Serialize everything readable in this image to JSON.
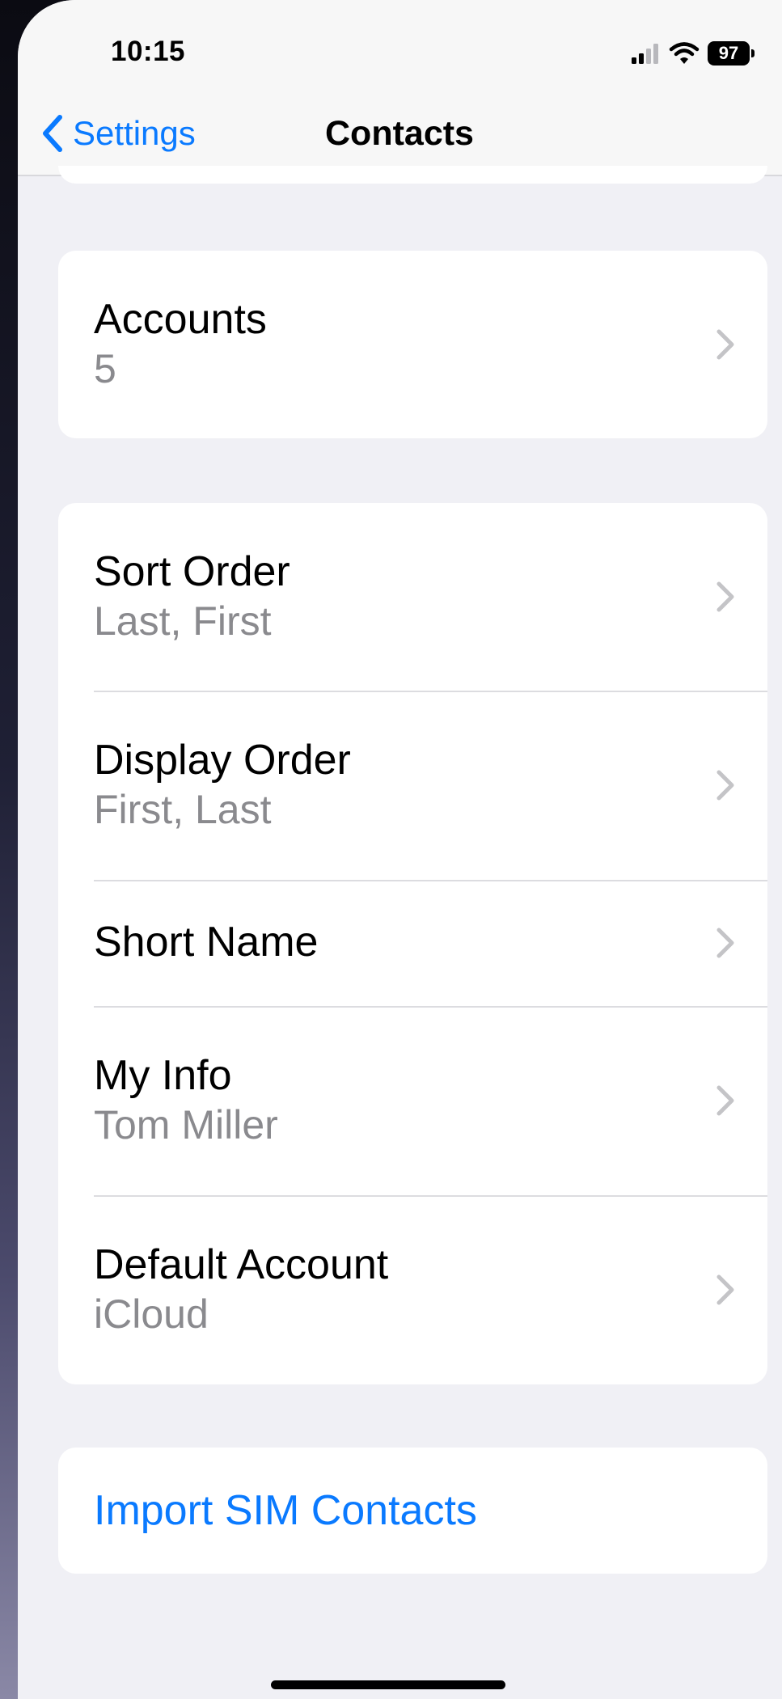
{
  "status_bar": {
    "time": "10:15",
    "battery_level": "97",
    "icons": [
      "cellular-signal-icon",
      "wifi-icon",
      "battery-icon"
    ]
  },
  "nav": {
    "back_label": "Settings",
    "title": "Contacts"
  },
  "accounts": {
    "title": "Accounts",
    "value": "5"
  },
  "settings_rows": [
    {
      "title": "Sort Order",
      "value": "Last, First"
    },
    {
      "title": "Display Order",
      "value": "First, Last"
    },
    {
      "title": "Short Name",
      "value": ""
    },
    {
      "title": "My Info",
      "value": "Tom Miller"
    },
    {
      "title": "Default Account",
      "value": "iCloud"
    }
  ],
  "import_button": {
    "label": "Import SIM Contacts"
  },
  "colors": {
    "accent": "#0a7aff",
    "background": "#f0f0f5",
    "secondary_text": "#8a8a8e"
  }
}
